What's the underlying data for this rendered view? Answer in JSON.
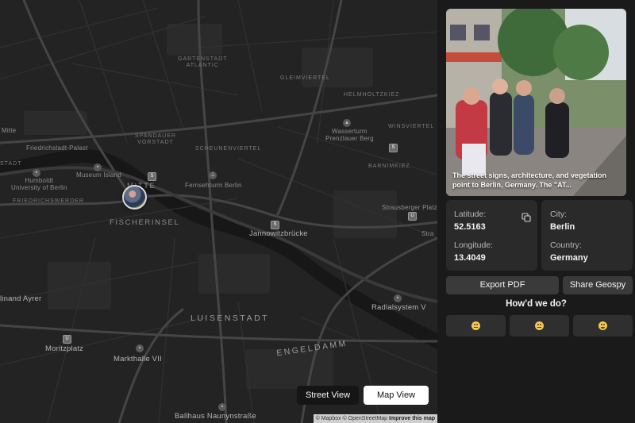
{
  "map": {
    "labels": {
      "gartenstadt": "GARTENSTADT\nATLANTIC",
      "gleimviertel": "GLEIMVIERTEL",
      "helmholtzkiez": "HELMHOLTZKIEZ",
      "winsviertel": "WINSVIERTEL",
      "wasserturm": "Wasserturm\nPrenzlauer Berg",
      "mitte_small": "Mitte",
      "spandauer": "SPANDAUER\nVORSTADT",
      "scheunenviertel": "SCHEUNENVIERTEL",
      "friedrichstadt_palast": "Friedrichstadt-Palast",
      "barnimkiez": "BARNIMKIEZ",
      "stadt": "STADT",
      "museum_island": "Museum Island",
      "humboldt": "Humboldt\nUniversity of Berlin",
      "mitte": "MITTE",
      "fernsehturm": "Fernsehturm Berlin",
      "friedrichswerder": "FRIEDRICHSWERDER",
      "strausberger": "Strausberger Platz",
      "fischerinsel": "FISCHERINSEL",
      "jannowitzbrucke": "Jannowitzbrücke",
      "stra_cut": "Stra",
      "linand": "linand Ayrer",
      "radialsystem": "Radialsystem V",
      "luisenstadt": "LUISENSTADT",
      "moritzplatz": "Moritzplatz",
      "engeldamm": "ENGELDAMM",
      "markthalle": "Markthalle VII",
      "ballhaus": "Ballhaus Naunynstraße"
    },
    "street_view_label": "Street View",
    "map_view_label": "Map View",
    "attribution_text": "© Mapbox © OpenStreetMap",
    "improve_label": "Improve this map"
  },
  "panel": {
    "photo_caption": "The street signs, architecture, and vegetation point to Berlin, Germany. The \"AT...",
    "latitude_label": "Latitude:",
    "latitude_value": "52.5163",
    "longitude_label": "Longitude:",
    "longitude_value": "13.4049",
    "city_label": "City:",
    "city_value": "Berlin",
    "country_label": "Country:",
    "country_value": "Germany",
    "export_label": "Export PDF",
    "share_label": "Share Geospy",
    "feedback_question": "How'd we do?",
    "ratings": [
      "sad-face-icon",
      "neutral-face-icon",
      "happy-face-icon"
    ]
  },
  "colors": {
    "map_background": "#232323",
    "panel_background": "#1a1a1a",
    "card_background": "#2a2a2a",
    "emoji_yellow": "#f2c94c"
  }
}
